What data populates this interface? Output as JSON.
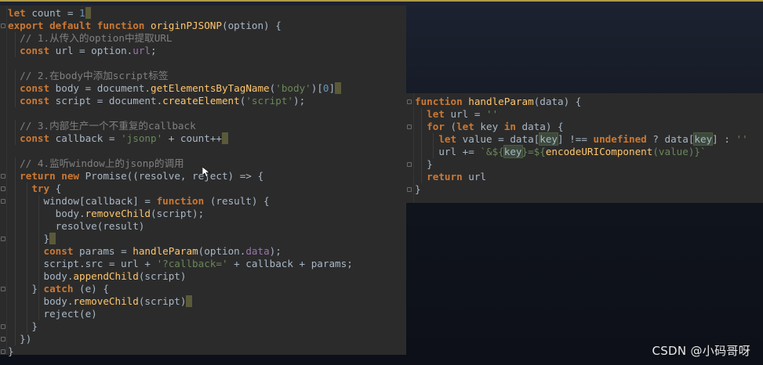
{
  "watermark": "CSDN @小码哥呀",
  "colors": {
    "editor_background": "#2b2b2b",
    "keyword": "#cc7832",
    "function": "#ffc66d",
    "string": "#6a8759",
    "comment": "#808080",
    "number": "#6897bb",
    "property": "#9876aa",
    "default_text": "#a9b7c6"
  },
  "main_editor": {
    "lines": [
      [
        [
          "kw",
          "let"
        ],
        [
          "",
          "&nbsp;count&nbsp;=&nbsp;"
        ],
        [
          "num",
          "1"
        ],
        [
          "caret",
          "_"
        ]
      ],
      [
        [
          "kw",
          "export&nbsp;default&nbsp;function"
        ],
        [
          "",
          "&nbsp;"
        ],
        [
          "fn",
          "originPJSONP"
        ],
        [
          "",
          "(option)&nbsp;{"
        ]
      ],
      [
        [
          "",
          "&nbsp;&nbsp;"
        ],
        [
          "cm",
          "//&nbsp;1.从传入的option中提取URL"
        ]
      ],
      [
        [
          "",
          "&nbsp;&nbsp;"
        ],
        [
          "kw",
          "const"
        ],
        [
          "",
          "&nbsp;url&nbsp;=&nbsp;option."
        ],
        [
          "prop",
          "url"
        ],
        [
          "",
          ";"
        ]
      ],
      [
        [
          "",
          ""
        ]
      ],
      [
        [
          "",
          "&nbsp;&nbsp;"
        ],
        [
          "cm",
          "//&nbsp;2.在body中添加script标签"
        ]
      ],
      [
        [
          "",
          "&nbsp;&nbsp;"
        ],
        [
          "kw",
          "const"
        ],
        [
          "",
          "&nbsp;body&nbsp;=&nbsp;document."
        ],
        [
          "fn",
          "getElementsByTagName"
        ],
        [
          "",
          "("
        ],
        [
          "str",
          "'body'"
        ],
        [
          "",
          ")["
        ],
        [
          "num",
          "0"
        ],
        [
          "",
          "]"
        ],
        [
          "caret",
          "_"
        ]
      ],
      [
        [
          "",
          "&nbsp;&nbsp;"
        ],
        [
          "kw",
          "const"
        ],
        [
          "",
          "&nbsp;script&nbsp;=&nbsp;document."
        ],
        [
          "fn",
          "createElement"
        ],
        [
          "",
          "("
        ],
        [
          "str",
          "'script'"
        ],
        [
          "",
          ");"
        ]
      ],
      [
        [
          "",
          ""
        ]
      ],
      [
        [
          "",
          "&nbsp;&nbsp;"
        ],
        [
          "cm",
          "//&nbsp;3.内部生产一个不重复的callback"
        ]
      ],
      [
        [
          "",
          "&nbsp;&nbsp;"
        ],
        [
          "kw",
          "const"
        ],
        [
          "",
          "&nbsp;callback&nbsp;=&nbsp;"
        ],
        [
          "str",
          "'jsonp'"
        ],
        [
          "",
          "&nbsp;+&nbsp;count++"
        ],
        [
          "caret",
          "_"
        ]
      ],
      [
        [
          "",
          ""
        ]
      ],
      [
        [
          "",
          "&nbsp;&nbsp;"
        ],
        [
          "cm",
          "//&nbsp;4.监听window上的jsonp的调用"
        ]
      ],
      [
        [
          "",
          "&nbsp;&nbsp;"
        ],
        [
          "kw",
          "return&nbsp;new"
        ],
        [
          "",
          "&nbsp;Promise((resolve,&nbsp;reject)&nbsp;=>&nbsp;{"
        ]
      ],
      [
        [
          "",
          "&nbsp;&nbsp;&nbsp;&nbsp;"
        ],
        [
          "kw",
          "try"
        ],
        [
          "",
          "&nbsp;{"
        ]
      ],
      [
        [
          "",
          "&nbsp;&nbsp;&nbsp;&nbsp;&nbsp;&nbsp;window[callback]&nbsp;=&nbsp;"
        ],
        [
          "kw",
          "function"
        ],
        [
          "",
          "&nbsp;(result)&nbsp;{"
        ]
      ],
      [
        [
          "",
          "&nbsp;&nbsp;&nbsp;&nbsp;&nbsp;&nbsp;&nbsp;&nbsp;body."
        ],
        [
          "fn",
          "removeChild"
        ],
        [
          "",
          "(script);"
        ]
      ],
      [
        [
          "",
          "&nbsp;&nbsp;&nbsp;&nbsp;&nbsp;&nbsp;&nbsp;&nbsp;resolve(result)"
        ]
      ],
      [
        [
          "",
          "&nbsp;&nbsp;&nbsp;&nbsp;&nbsp;&nbsp;}"
        ],
        [
          "caret",
          "_"
        ]
      ],
      [
        [
          "",
          "&nbsp;&nbsp;&nbsp;&nbsp;&nbsp;&nbsp;"
        ],
        [
          "kw",
          "const"
        ],
        [
          "",
          "&nbsp;params&nbsp;=&nbsp;"
        ],
        [
          "fn",
          "handleParam"
        ],
        [
          "",
          "(option."
        ],
        [
          "prop",
          "data"
        ],
        [
          "",
          ");"
        ]
      ],
      [
        [
          "",
          "&nbsp;&nbsp;&nbsp;&nbsp;&nbsp;&nbsp;script.src&nbsp;=&nbsp;url&nbsp;+&nbsp;"
        ],
        [
          "str",
          "'?callback='"
        ],
        [
          "",
          "&nbsp;+&nbsp;callback&nbsp;+&nbsp;params;"
        ]
      ],
      [
        [
          "",
          "&nbsp;&nbsp;&nbsp;&nbsp;&nbsp;&nbsp;body."
        ],
        [
          "fn",
          "appendChild"
        ],
        [
          "",
          "(script)"
        ]
      ],
      [
        [
          "",
          "&nbsp;&nbsp;&nbsp;&nbsp;}&nbsp;"
        ],
        [
          "kw",
          "catch"
        ],
        [
          "",
          "&nbsp;(e)&nbsp;{"
        ]
      ],
      [
        [
          "",
          "&nbsp;&nbsp;&nbsp;&nbsp;&nbsp;&nbsp;body."
        ],
        [
          "fn",
          "removeChild"
        ],
        [
          "",
          "(script)"
        ],
        [
          "caret",
          "_"
        ]
      ],
      [
        [
          "",
          "&nbsp;&nbsp;&nbsp;&nbsp;&nbsp;&nbsp;reject(e)"
        ]
      ],
      [
        [
          "",
          "&nbsp;&nbsp;&nbsp;&nbsp;}"
        ]
      ],
      [
        [
          "",
          "&nbsp;&nbsp;})"
        ]
      ],
      [
        [
          "",
          "}"
        ]
      ]
    ]
  },
  "side_editor": {
    "lines": [
      [
        [
          "kw",
          "function"
        ],
        [
          "",
          "&nbsp;"
        ],
        [
          "fn",
          "handleParam"
        ],
        [
          "",
          "(data)&nbsp;{"
        ]
      ],
      [
        [
          "",
          "&nbsp;&nbsp;"
        ],
        [
          "kw",
          "let"
        ],
        [
          "",
          "&nbsp;url&nbsp;=&nbsp;"
        ],
        [
          "str",
          "''"
        ]
      ],
      [
        [
          "",
          "&nbsp;&nbsp;"
        ],
        [
          "kw",
          "for"
        ],
        [
          "",
          "&nbsp;("
        ],
        [
          "kw",
          "let"
        ],
        [
          "",
          "&nbsp;key&nbsp;"
        ],
        [
          "kw",
          "in"
        ],
        [
          "",
          "&nbsp;data)&nbsp;{"
        ]
      ],
      [
        [
          "",
          "&nbsp;&nbsp;&nbsp;&nbsp;"
        ],
        [
          "kw",
          "let"
        ],
        [
          "",
          "&nbsp;value&nbsp;=&nbsp;data["
        ],
        [
          "hl",
          "key"
        ],
        [
          "",
          "]&nbsp;!==&nbsp;"
        ],
        [
          "kw",
          "undefined"
        ],
        [
          "",
          "&nbsp;?&nbsp;data["
        ],
        [
          "hl",
          "key"
        ],
        [
          "",
          "]&nbsp;:&nbsp;"
        ],
        [
          "str",
          "''"
        ]
      ],
      [
        [
          "",
          "&nbsp;&nbsp;&nbsp;&nbsp;url&nbsp;+=&nbsp;"
        ],
        [
          "str",
          "`&amp;${"
        ],
        [
          "hl",
          "key"
        ],
        [
          "str",
          "}=${"
        ],
        [
          "fn",
          "encodeURIComponent"
        ],
        [
          "str",
          "(value)}`"
        ]
      ],
      [
        [
          "",
          "&nbsp;&nbsp;}"
        ]
      ],
      [
        [
          "",
          "&nbsp;&nbsp;"
        ],
        [
          "kw",
          "return"
        ],
        [
          "",
          "&nbsp;url"
        ]
      ],
      [
        [
          "",
          "}"
        ]
      ]
    ]
  }
}
